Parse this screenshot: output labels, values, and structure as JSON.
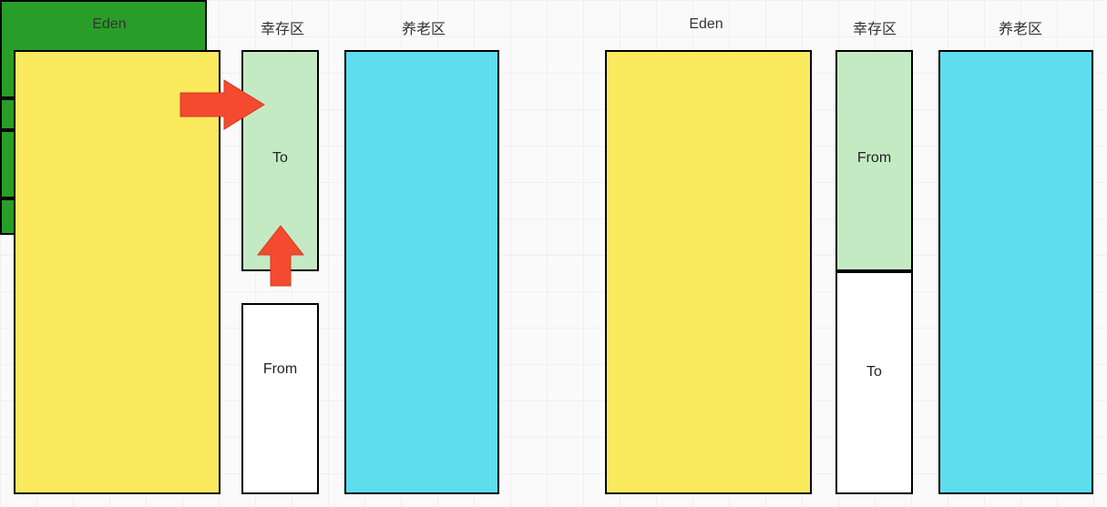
{
  "left": {
    "eden_label": "Eden",
    "survivor_label": "幸存区",
    "old_label": "养老区",
    "to_label": "To",
    "from_label": "From"
  },
  "right": {
    "eden_label": "Eden",
    "survivor_label": "幸存区",
    "old_label": "养老区",
    "from_label": "From",
    "to_label": "To"
  },
  "colors": {
    "eden": "#fbe95e",
    "green": "#289e28",
    "lightgreen": "#c4eac4",
    "cyan": "#5edded",
    "arrow": "#f44a2f"
  }
}
